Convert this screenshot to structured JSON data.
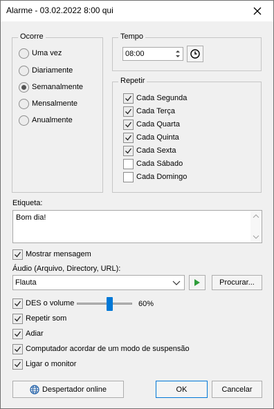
{
  "window": {
    "title": "Alarme - 03.02.2022 8:00 qui"
  },
  "ocorre": {
    "label": "Ocorre",
    "options": [
      "Uma vez",
      "Diariamente",
      "Semanalmente",
      "Mensalmente",
      "Anualmente"
    ],
    "selected": "Semanalmente"
  },
  "tempo": {
    "label": "Tempo",
    "time_value": "08:00"
  },
  "repetir": {
    "label": "Repetir",
    "days": [
      {
        "label": "Cada Segunda",
        "checked": true
      },
      {
        "label": "Cada Terça",
        "checked": true
      },
      {
        "label": "Cada Quarta",
        "checked": true
      },
      {
        "label": "Cada Quinta",
        "checked": true
      },
      {
        "label": "Cada Sexta",
        "checked": true
      },
      {
        "label": "Cada Sábado",
        "checked": false
      },
      {
        "label": "Cada Domingo",
        "checked": false
      }
    ]
  },
  "etiqueta": {
    "label": "Etiqueta:",
    "value": "Bom dia!"
  },
  "mostrar_mensagem": {
    "label": "Mostrar mensagem",
    "checked": true
  },
  "audio": {
    "label": "Áudio (Arquivo, Directory, URL):",
    "selected": "Flauta",
    "browse_label": "Procurar..."
  },
  "volume": {
    "label": "DES o volume",
    "value_text": "60%",
    "level": 0.6,
    "checked": true
  },
  "options": [
    {
      "key": "repetir_som",
      "label": "Repetir som",
      "checked": true
    },
    {
      "key": "adiar",
      "label": "Adiar",
      "checked": true
    },
    {
      "key": "acordar",
      "label": "Computador acordar de um modo de suspensão",
      "checked": true
    },
    {
      "key": "ligar_monitor",
      "label": "Ligar o monitor",
      "checked": true
    }
  ],
  "footer": {
    "online_label": "Despertador online",
    "ok_label": "OK",
    "cancel_label": "Cancelar"
  },
  "colors": {
    "accent": "#0078d7",
    "play_green": "#2e9d3a",
    "background": "#f0f0f0",
    "group_border": "#c6c6c6"
  }
}
